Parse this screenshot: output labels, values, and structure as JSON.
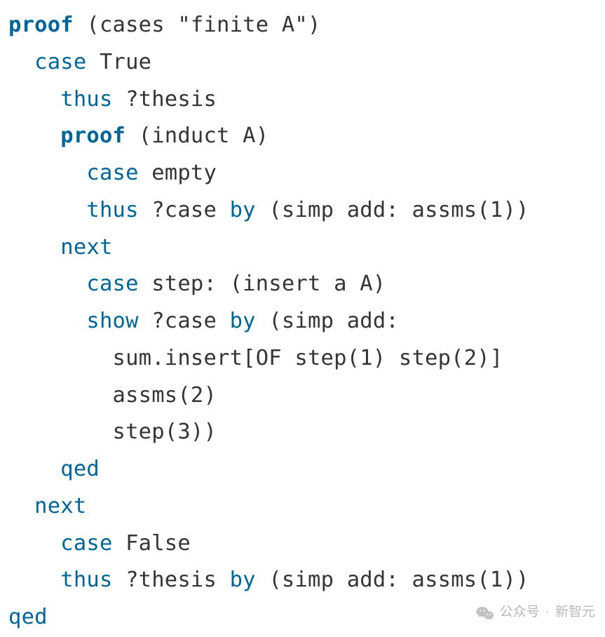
{
  "code": {
    "lines": [
      {
        "indent": 0,
        "tokens": [
          {
            "cls": "kw-bold",
            "t": "proof"
          },
          {
            "cls": "plain",
            "t": " (cases \"finite A\")"
          }
        ]
      },
      {
        "indent": 1,
        "tokens": [
          {
            "cls": "kw",
            "t": "case"
          },
          {
            "cls": "plain",
            "t": " True"
          }
        ]
      },
      {
        "indent": 2,
        "tokens": [
          {
            "cls": "kw",
            "t": "thus"
          },
          {
            "cls": "plain",
            "t": " ?thesis"
          }
        ]
      },
      {
        "indent": 2,
        "tokens": [
          {
            "cls": "kw-bold",
            "t": "proof"
          },
          {
            "cls": "plain",
            "t": " (induct A)"
          }
        ]
      },
      {
        "indent": 3,
        "tokens": [
          {
            "cls": "kw",
            "t": "case"
          },
          {
            "cls": "plain",
            "t": " empty"
          }
        ]
      },
      {
        "indent": 3,
        "tokens": [
          {
            "cls": "kw",
            "t": "thus"
          },
          {
            "cls": "plain",
            "t": " ?case "
          },
          {
            "cls": "kw",
            "t": "by"
          },
          {
            "cls": "plain",
            "t": " (simp add: assms(1))"
          }
        ]
      },
      {
        "indent": 2,
        "tokens": [
          {
            "cls": "kw",
            "t": "next"
          }
        ]
      },
      {
        "indent": 3,
        "tokens": [
          {
            "cls": "kw",
            "t": "case"
          },
          {
            "cls": "plain",
            "t": " step: (insert a A)"
          }
        ]
      },
      {
        "indent": 3,
        "tokens": [
          {
            "cls": "kw",
            "t": "show"
          },
          {
            "cls": "plain",
            "t": " ?case "
          },
          {
            "cls": "kw",
            "t": "by"
          },
          {
            "cls": "plain",
            "t": " (simp add:"
          }
        ]
      },
      {
        "indent": 4,
        "tokens": [
          {
            "cls": "plain",
            "t": "sum.insert[OF step(1) step(2)]"
          }
        ]
      },
      {
        "indent": 4,
        "tokens": [
          {
            "cls": "plain",
            "t": "assms(2)"
          }
        ]
      },
      {
        "indent": 4,
        "tokens": [
          {
            "cls": "plain",
            "t": "step(3))"
          }
        ]
      },
      {
        "indent": 2,
        "tokens": [
          {
            "cls": "kw",
            "t": "qed"
          }
        ]
      },
      {
        "indent": 1,
        "tokens": [
          {
            "cls": "kw",
            "t": "next"
          }
        ]
      },
      {
        "indent": 2,
        "tokens": [
          {
            "cls": "kw",
            "t": "case"
          },
          {
            "cls": "plain",
            "t": " False"
          }
        ]
      },
      {
        "indent": 2,
        "tokens": [
          {
            "cls": "kw",
            "t": "thus"
          },
          {
            "cls": "plain",
            "t": " ?thesis "
          },
          {
            "cls": "kw",
            "t": "by"
          },
          {
            "cls": "plain",
            "t": " (simp add: assms(1))"
          }
        ]
      },
      {
        "indent": 0,
        "tokens": [
          {
            "cls": "kw",
            "t": "qed"
          }
        ]
      }
    ],
    "indent_unit": "  "
  },
  "watermark": {
    "label": "公众号",
    "separator": "·",
    "name": "新智元"
  }
}
